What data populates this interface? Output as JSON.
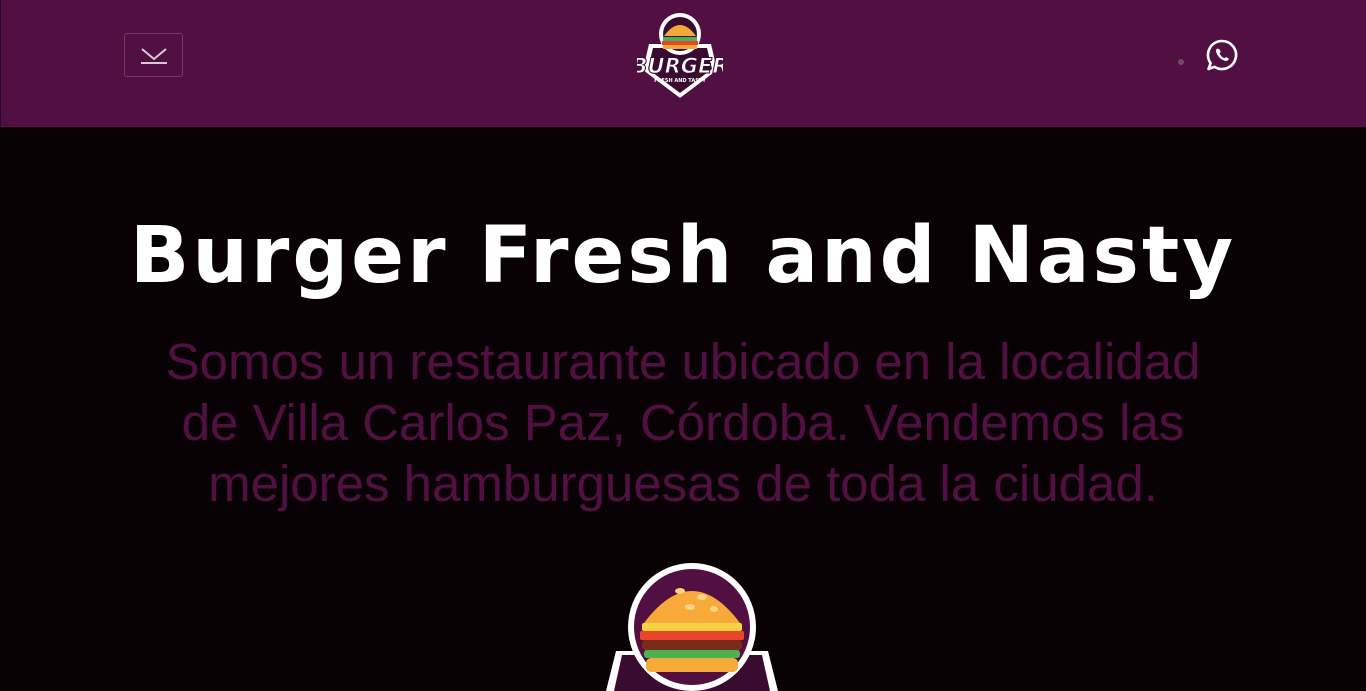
{
  "brand": {
    "logo_text": "BURGER",
    "logo_tagline": "FRESH AND TASTY"
  },
  "navbar": {
    "menu_icon": "chevron-down-icon",
    "contact_icon": "whatsapp-icon"
  },
  "hero": {
    "title": "Burger Fresh and Nasty",
    "description": "Somos un restaurante ubicado en la localidad de Villa Carlos Paz, Córdoba. Vendemos las mejores hamburguesas de toda la ciudad."
  },
  "colors": {
    "navbar_bg": "#521042",
    "page_bg": "#080205",
    "accent": "#521042",
    "title": "#ffffff"
  }
}
